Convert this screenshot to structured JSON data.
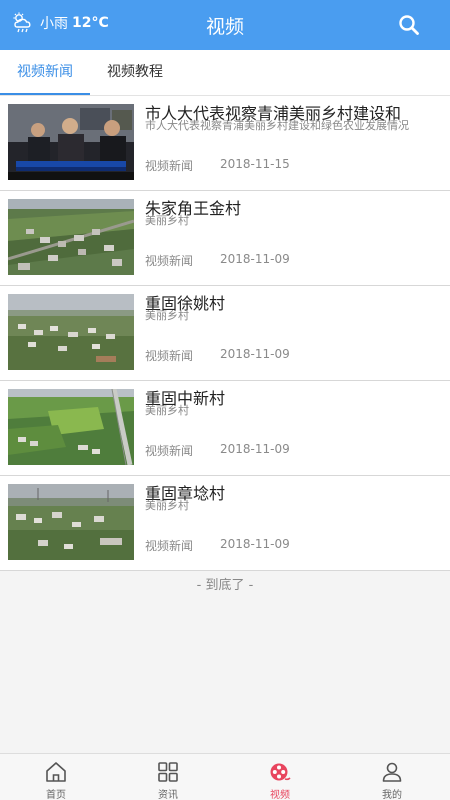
{
  "header": {
    "weather_text": "小雨",
    "weather_temp": "12°C",
    "title": "视频",
    "search_icon": "search-icon"
  },
  "tabs": [
    {
      "label": "视频新闻",
      "active": true
    },
    {
      "label": "视频教程",
      "active": false
    }
  ],
  "videos": [
    {
      "title": "市人大代表视察青浦美丽乡村建设和",
      "subtitle": "市人大代表视察青浦美丽乡村建设和绿色农业发展情况",
      "category": "视频新闻",
      "date": "2018-11-15"
    },
    {
      "title": "朱家角王金村",
      "subtitle": "美丽乡村",
      "category": "视频新闻",
      "date": "2018-11-09"
    },
    {
      "title": "重固徐姚村",
      "subtitle": "美丽乡村",
      "category": "视频新闻",
      "date": "2018-11-09"
    },
    {
      "title": "重固中新村",
      "subtitle": "美丽乡村",
      "category": "视频新闻",
      "date": "2018-11-09"
    },
    {
      "title": "重固章埝村",
      "subtitle": "美丽乡村",
      "category": "视频新闻",
      "date": "2018-11-09"
    }
  ],
  "end_text": "- 到底了 -",
  "bottom_nav": [
    {
      "label": "首页",
      "icon": "home-icon"
    },
    {
      "label": "资讯",
      "icon": "grid-icon"
    },
    {
      "label": "视频",
      "icon": "video-reel-icon",
      "active": true
    },
    {
      "label": "我的",
      "icon": "user-icon"
    }
  ],
  "colors": {
    "header_bg": "#4a9df0",
    "tab_active": "#3a8ee6",
    "nav_active": "#e8455e"
  }
}
